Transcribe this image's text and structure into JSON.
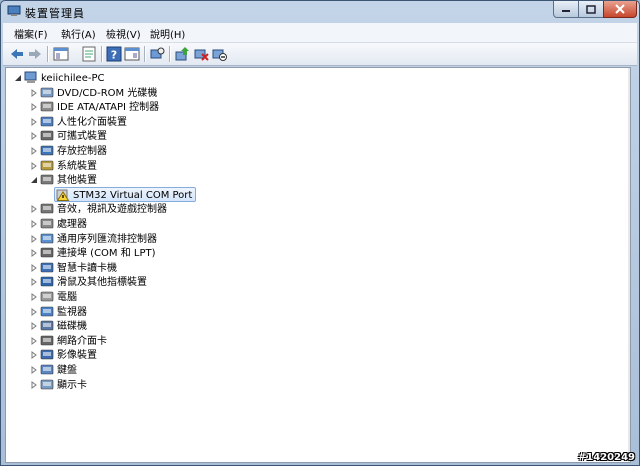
{
  "window": {
    "title": "裝置管理員"
  },
  "menu": [
    "檔案(F)",
    "執行(A)",
    "檢視(V)",
    "說明(H)"
  ],
  "tree": {
    "root": "keiichilee-PC",
    "items": [
      {
        "label": "DVD/CD-ROM 光碟機",
        "icon": "dvd-drive-icon",
        "expanded": false
      },
      {
        "label": "IDE ATA/ATAPI 控制器",
        "icon": "ide-controller-icon",
        "expanded": false
      },
      {
        "label": "人性化介面裝置",
        "icon": "hid-icon",
        "expanded": false
      },
      {
        "label": "可攜式裝置",
        "icon": "portable-device-icon",
        "expanded": false
      },
      {
        "label": "存放控制器",
        "icon": "storage-controller-icon",
        "expanded": false
      },
      {
        "label": "系統裝置",
        "icon": "system-device-icon",
        "expanded": false
      },
      {
        "label": "其他裝置",
        "icon": "other-device-icon",
        "expanded": true,
        "children": [
          {
            "label": "STM32 Virtual COM Port",
            "icon": "warning-device-icon"
          }
        ]
      },
      {
        "label": "音效，視訊及遊戲控制器",
        "icon": "sound-icon",
        "expanded": false
      },
      {
        "label": "處理器",
        "icon": "processor-icon",
        "expanded": false
      },
      {
        "label": "通用序列匯流排控制器",
        "icon": "usb-icon",
        "expanded": false
      },
      {
        "label": "連接埠 (COM 和 LPT)",
        "icon": "port-icon",
        "expanded": false
      },
      {
        "label": "智慧卡讀卡機",
        "icon": "smartcard-reader-icon",
        "expanded": false
      },
      {
        "label": "滑鼠及其他指標裝置",
        "icon": "mouse-icon",
        "expanded": false
      },
      {
        "label": "電腦",
        "icon": "computer-icon",
        "expanded": false
      },
      {
        "label": "監視器",
        "icon": "monitor-icon",
        "expanded": false
      },
      {
        "label": "磁碟機",
        "icon": "disk-drive-icon",
        "expanded": false
      },
      {
        "label": "網路介面卡",
        "icon": "network-adapter-icon",
        "expanded": false
      },
      {
        "label": "影像裝置",
        "icon": "imaging-device-icon",
        "expanded": false
      },
      {
        "label": "鍵盤",
        "icon": "keyboard-icon",
        "expanded": false
      },
      {
        "label": "顯示卡",
        "icon": "display-adapter-icon",
        "expanded": false
      }
    ]
  },
  "watermark": "#1420249"
}
